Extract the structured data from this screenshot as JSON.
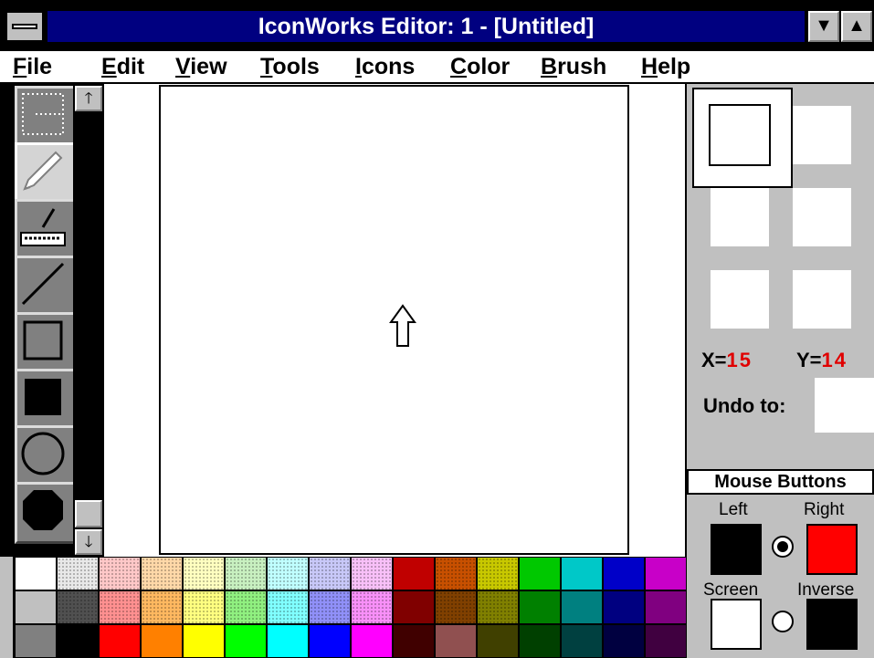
{
  "window": {
    "title": "IconWorks Editor: 1 - [Untitled]",
    "minimize_glyph": "▼",
    "maximize_glyph": "▲"
  },
  "menu": [
    {
      "label": "File",
      "mnemonic": "F"
    },
    {
      "label": "Edit",
      "mnemonic": "E"
    },
    {
      "label": "View",
      "mnemonic": "V"
    },
    {
      "label": "Tools",
      "mnemonic": "T"
    },
    {
      "label": "Icons",
      "mnemonic": "I"
    },
    {
      "label": "Color",
      "mnemonic": "C"
    },
    {
      "label": "Brush",
      "mnemonic": "B"
    },
    {
      "label": "Help",
      "mnemonic": "H"
    }
  ],
  "tools": [
    {
      "name": "selection-tool",
      "icon": "dotted-rectangle-icon",
      "selected": false
    },
    {
      "name": "pencil-tool",
      "icon": "pencil-icon",
      "selected": true
    },
    {
      "name": "fill-tool",
      "icon": "paint-brush-fill-icon",
      "selected": false
    },
    {
      "name": "line-tool",
      "icon": "line-icon",
      "selected": false
    },
    {
      "name": "hollow-rectangle-tool",
      "icon": "rectangle-outline-icon",
      "selected": false
    },
    {
      "name": "filled-rectangle-tool",
      "icon": "rectangle-filled-icon",
      "selected": false
    },
    {
      "name": "hollow-ellipse-tool",
      "icon": "ellipse-outline-icon",
      "selected": false
    },
    {
      "name": "filled-ellipse-tool",
      "icon": "ellipse-filled-icon",
      "selected": false
    }
  ],
  "scroll": {
    "up_glyph": "🡑",
    "down_glyph": "🡓"
  },
  "status": {
    "x_label": "X=",
    "x_value": "15",
    "y_label": "Y=",
    "y_value": "14",
    "undo_label": "Undo to:"
  },
  "mouse_buttons": {
    "title": "Mouse Buttons",
    "left_label": "Left",
    "right_label": "Right",
    "screen_label": "Screen",
    "inverse_label": "Inverse",
    "left_color": "#000000",
    "right_color": "#ff0000",
    "screen_color": "#ffffff",
    "inverse_color": "#000000"
  },
  "palette": [
    [
      "#ffffff",
      "#e8e8e8",
      "#ffc8c8",
      "#ffd8a8",
      "#ffffc0",
      "#c8f0c0",
      "#c0ffff",
      "#c8c8f8",
      "#f8c0f8",
      "#c00000",
      "#c85000",
      "#c8c800",
      "#00c800",
      "#00c8c8",
      "#0000c8",
      "#c800c8"
    ],
    [
      "#c0c0c0",
      "#505050",
      "#ff9090",
      "#ffb860",
      "#ffff80",
      "#90f080",
      "#80ffff",
      "#9090f8",
      "#f890f8",
      "#800000",
      "#804000",
      "#808000",
      "#008000",
      "#008080",
      "#000080",
      "#800080"
    ],
    [
      "#808080",
      "#000000",
      "#ff0000",
      "#ff8000",
      "#ffff00",
      "#00ff00",
      "#00ffff",
      "#0000ff",
      "#ff00ff",
      "#400000",
      "#905050",
      "#404000",
      "#004000",
      "#004040",
      "#000040",
      "#400040"
    ]
  ],
  "pattern_cols": [
    1,
    2,
    3,
    4,
    5,
    6,
    7,
    8,
    10,
    11
  ]
}
